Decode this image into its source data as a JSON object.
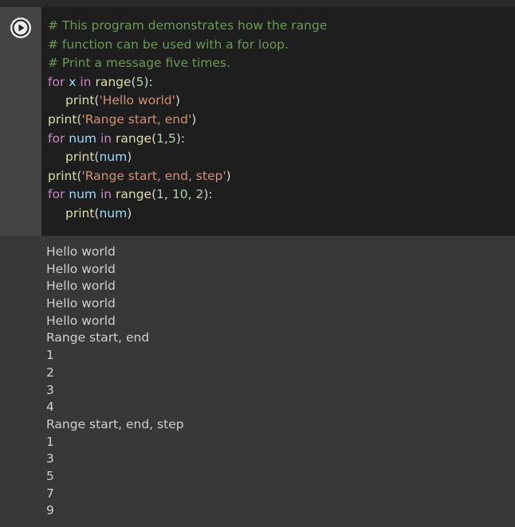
{
  "code_lines": [
    {
      "indent": false,
      "tokens": [
        {
          "t": "comment",
          "v": "# This program demonstrates how the range"
        }
      ]
    },
    {
      "indent": false,
      "tokens": [
        {
          "t": "comment",
          "v": "# function can be used with a for loop."
        }
      ]
    },
    {
      "indent": false,
      "tokens": [
        {
          "t": "comment",
          "v": "# Print a message five times."
        }
      ]
    },
    {
      "indent": false,
      "tokens": [
        {
          "t": "kw",
          "v": "for"
        },
        {
          "t": "plain",
          "v": " "
        },
        {
          "t": "var",
          "v": "x"
        },
        {
          "t": "plain",
          "v": " "
        },
        {
          "t": "kw",
          "v": "in"
        },
        {
          "t": "plain",
          "v": " "
        },
        {
          "t": "fn",
          "v": "range"
        },
        {
          "t": "plain",
          "v": "("
        },
        {
          "t": "num",
          "v": "5"
        },
        {
          "t": "plain",
          "v": "):"
        }
      ]
    },
    {
      "indent": true,
      "tokens": [
        {
          "t": "fn",
          "v": "print"
        },
        {
          "t": "plain",
          "v": "("
        },
        {
          "t": "str",
          "v": "'Hello world'"
        },
        {
          "t": "plain",
          "v": ")"
        }
      ]
    },
    {
      "indent": false,
      "tokens": [
        {
          "t": "fn",
          "v": "print"
        },
        {
          "t": "plain",
          "v": "("
        },
        {
          "t": "str",
          "v": "'Range start, end'"
        },
        {
          "t": "plain",
          "v": ")"
        }
      ]
    },
    {
      "indent": false,
      "tokens": [
        {
          "t": "kw",
          "v": "for"
        },
        {
          "t": "plain",
          "v": " "
        },
        {
          "t": "var",
          "v": "num"
        },
        {
          "t": "plain",
          "v": " "
        },
        {
          "t": "kw",
          "v": "in"
        },
        {
          "t": "plain",
          "v": " "
        },
        {
          "t": "fn",
          "v": "range"
        },
        {
          "t": "plain",
          "v": "("
        },
        {
          "t": "num",
          "v": "1"
        },
        {
          "t": "plain",
          "v": ","
        },
        {
          "t": "num",
          "v": "5"
        },
        {
          "t": "plain",
          "v": "):"
        }
      ]
    },
    {
      "indent": true,
      "tokens": [
        {
          "t": "fn",
          "v": "print"
        },
        {
          "t": "plain",
          "v": "("
        },
        {
          "t": "var",
          "v": "num"
        },
        {
          "t": "plain",
          "v": ")"
        }
      ]
    },
    {
      "indent": false,
      "tokens": [
        {
          "t": "fn",
          "v": "print"
        },
        {
          "t": "plain",
          "v": "("
        },
        {
          "t": "str",
          "v": "'Range start, end, step'"
        },
        {
          "t": "plain",
          "v": ")"
        }
      ]
    },
    {
      "indent": false,
      "tokens": [
        {
          "t": "kw",
          "v": "for"
        },
        {
          "t": "plain",
          "v": " "
        },
        {
          "t": "var",
          "v": "num"
        },
        {
          "t": "plain",
          "v": " "
        },
        {
          "t": "kw",
          "v": "in"
        },
        {
          "t": "plain",
          "v": " "
        },
        {
          "t": "fn",
          "v": "range"
        },
        {
          "t": "plain",
          "v": "("
        },
        {
          "t": "num",
          "v": "1"
        },
        {
          "t": "plain",
          "v": ", "
        },
        {
          "t": "num",
          "v": "10"
        },
        {
          "t": "plain",
          "v": ", "
        },
        {
          "t": "num",
          "v": "2"
        },
        {
          "t": "plain",
          "v": "):"
        }
      ]
    },
    {
      "indent": true,
      "tokens": [
        {
          "t": "fn",
          "v": "print"
        },
        {
          "t": "plain",
          "v": "("
        },
        {
          "t": "var",
          "v": "num"
        },
        {
          "t": "plain",
          "v": ")"
        }
      ]
    }
  ],
  "output_lines": [
    "Hello world",
    "Hello world",
    "Hello world",
    "Hello world",
    "Hello world",
    "Range start, end",
    "1",
    "2",
    "3",
    "4",
    "Range start, end, step",
    "1",
    "3",
    "5",
    "7",
    "9"
  ],
  "run_button": {
    "icon": "play-icon"
  },
  "colors": {
    "comment": "#6a9955",
    "keyword": "#c586c0",
    "variable": "#9cdcfe",
    "function": "#dcdcaa",
    "string": "#ce9178",
    "number": "#b5cea8"
  }
}
